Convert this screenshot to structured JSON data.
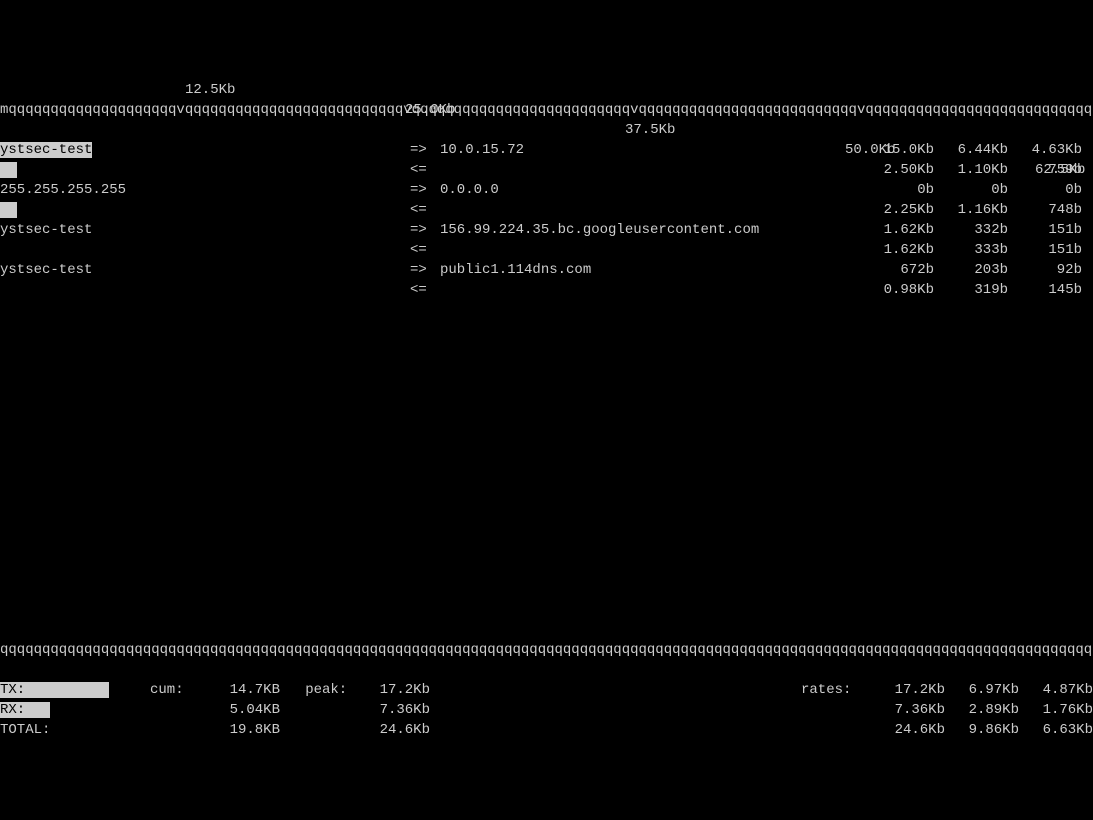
{
  "scale": [
    "12.5Kb",
    "25.0Kb",
    "37.5Kb",
    "50.0Kb",
    "62.5Kb"
  ],
  "ruler_top": "mqqqqqqqqqqqqqqqqqqqqvqqqqqqqqqqqqqqqqqqqqqqqqqqvqqqqqqqqqqqqqqqqqqqqqqqqqqvqqqqqqqqqqqqqqqqqqqqqqqqqqvqqqqqqqqqqqqqqqqqqqqqqqqqqq",
  "ruler_mid": "qqqqqqqqqqqqqqqqqqqqqqqqqqqqqqqqqqqqqqqqqqqqqqqqqqqqqqqqqqqqqqqqqqqqqqqqqqqqqqqqqqqqqqqqqqqqqqqqqqqqqqqqqqqqqqqqqqqqqqqqqqqqqqqqqqqq",
  "connections": [
    {
      "src": "ystsec-test",
      "src_hl": true,
      "arrow": "=>",
      "dest": "10.0.15.72",
      "r1": "15.0Kb",
      "r2": "6.44Kb",
      "r3": "4.63Kb"
    },
    {
      "src": "",
      "src_hl": true,
      "src_pad": 2,
      "arrow": "<=",
      "dest": "",
      "r1": "2.50Kb",
      "r2": "1.10Kb",
      "r3": "759b"
    },
    {
      "src": "255.255.255.255",
      "src_hl": false,
      "arrow": "=>",
      "dest": "0.0.0.0",
      "r1": "0b",
      "r2": "0b",
      "r3": "0b"
    },
    {
      "src": "",
      "src_hl": true,
      "src_pad": 2,
      "arrow": "<=",
      "dest": "",
      "r1": "2.25Kb",
      "r2": "1.16Kb",
      "r3": "748b"
    },
    {
      "src": "ystsec-test",
      "src_hl": false,
      "arrow": "=>",
      "dest": "156.99.224.35.bc.googleusercontent.com",
      "r1": "1.62Kb",
      "r2": "332b",
      "r3": "151b"
    },
    {
      "src": "",
      "src_hl": false,
      "arrow": "<=",
      "dest": "",
      "r1": "1.62Kb",
      "r2": "333b",
      "r3": "151b"
    },
    {
      "src": "ystsec-test",
      "src_hl": false,
      "arrow": "=>",
      "dest": "public1.114dns.com",
      "r1": "672b",
      "r2": "203b",
      "r3": "92b"
    },
    {
      "src": "",
      "src_hl": false,
      "arrow": "<=",
      "dest": "",
      "r1": "0.98Kb",
      "r2": "319b",
      "r3": "145b"
    }
  ],
  "footer": {
    "cum_label": "cum:",
    "peak_label": "peak:",
    "rates_label": "rates:",
    "rows": [
      {
        "label": "TX:",
        "label_hl": true,
        "bar_hl": 10,
        "cum": "14.7KB",
        "peak": "17.2Kb",
        "r1": "17.2Kb",
        "r2": "6.97Kb",
        "r3": "4.87Kb"
      },
      {
        "label": "RX:",
        "label_hl": true,
        "bar_hl": 3,
        "cum": "5.04KB",
        "peak": "7.36Kb",
        "r1": "7.36Kb",
        "r2": "2.89Kb",
        "r3": "1.76Kb"
      },
      {
        "label": "TOTAL:",
        "label_hl": false,
        "bar_hl": 0,
        "cum": "19.8KB",
        "peak": "24.6Kb",
        "r1": "24.6Kb",
        "r2": "9.86Kb",
        "r3": "6.63Kb"
      }
    ]
  }
}
